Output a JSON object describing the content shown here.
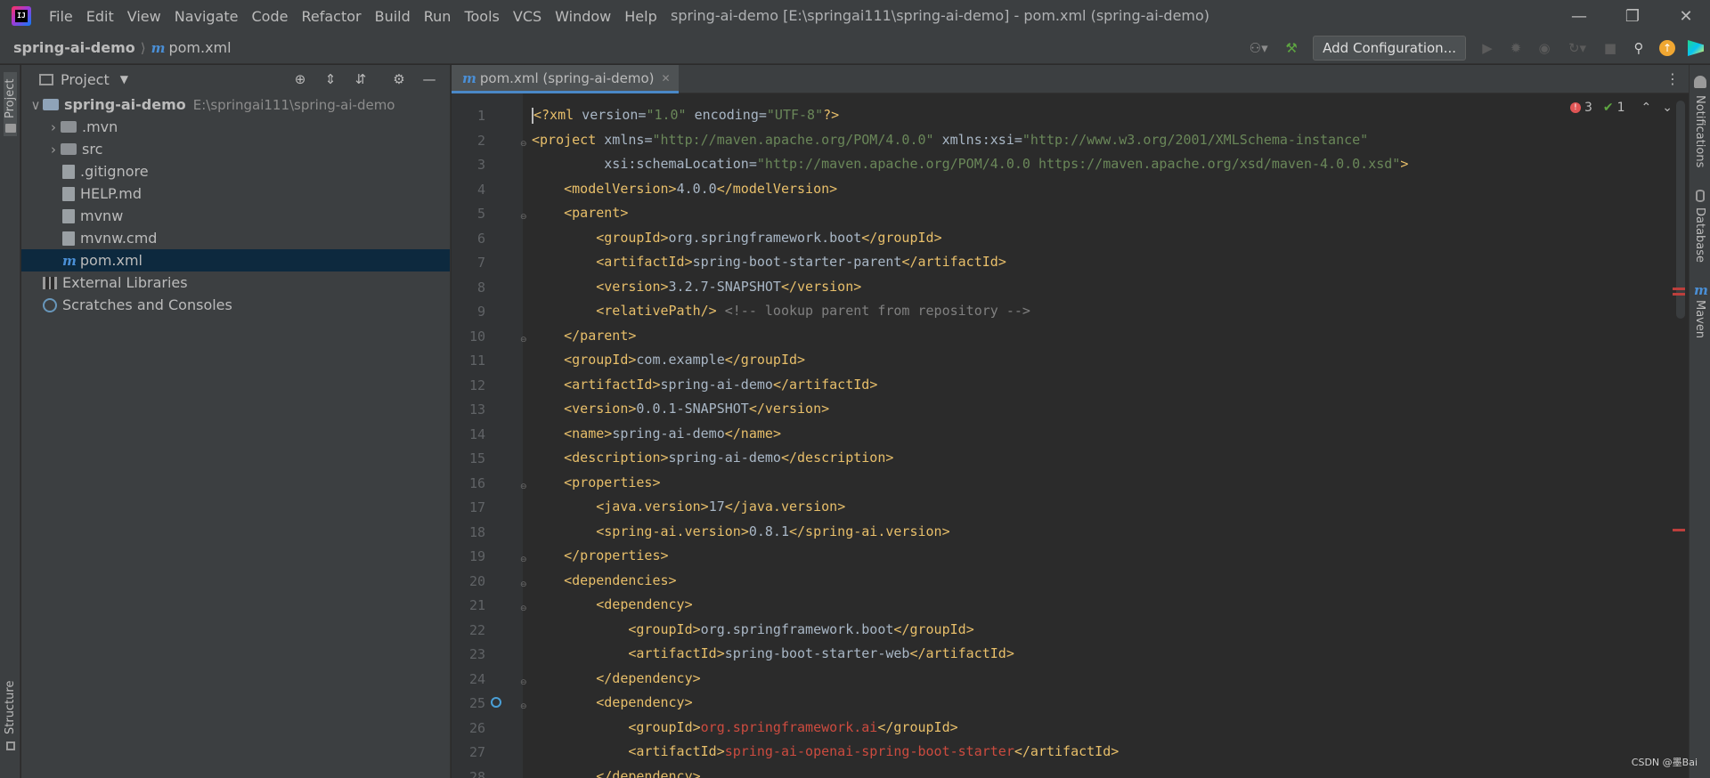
{
  "window": {
    "title": "spring-ai-demo [E:\\springai111\\spring-ai-demo] - pom.xml (spring-ai-demo)",
    "menu": [
      "File",
      "Edit",
      "View",
      "Navigate",
      "Code",
      "Refactor",
      "Build",
      "Run",
      "Tools",
      "VCS",
      "Window",
      "Help"
    ]
  },
  "breadcrumb": {
    "project": "spring-ai-demo",
    "file": "pom.xml"
  },
  "toolbar": {
    "add_configuration": "Add Configuration..."
  },
  "project_panel": {
    "title": "Project",
    "tree": [
      {
        "label": "spring-ai-demo",
        "path": "E:\\springai111\\spring-ai-demo",
        "type": "module",
        "indent": 0,
        "expanded": true
      },
      {
        "label": ".mvn",
        "type": "folder",
        "indent": 1,
        "expanded": false
      },
      {
        "label": "src",
        "type": "folder",
        "indent": 1,
        "expanded": false
      },
      {
        "label": ".gitignore",
        "type": "file",
        "indent": 1
      },
      {
        "label": "HELP.md",
        "type": "file",
        "indent": 1
      },
      {
        "label": "mvnw",
        "type": "file",
        "indent": 1
      },
      {
        "label": "mvnw.cmd",
        "type": "file",
        "indent": 1
      },
      {
        "label": "pom.xml",
        "type": "maven",
        "indent": 1,
        "selected": true
      },
      {
        "label": "External Libraries",
        "type": "libraries",
        "indent": 0
      },
      {
        "label": "Scratches and Consoles",
        "type": "scratches",
        "indent": 0
      }
    ]
  },
  "left_tools": {
    "project": "Project",
    "structure": "Structure"
  },
  "right_tools": {
    "notifications": "Notifications",
    "database": "Database",
    "maven": "Maven"
  },
  "editor": {
    "tab_label": "pom.xml (spring-ai-demo)",
    "inspection": {
      "errors": "3",
      "ok": "1"
    },
    "line_numbers": [
      "1",
      "2",
      "3",
      "4",
      "5",
      "6",
      "7",
      "8",
      "9",
      "10",
      "11",
      "12",
      "13",
      "14",
      "15",
      "16",
      "17",
      "18",
      "19",
      "20",
      "21",
      "22",
      "23",
      "24",
      "25",
      "26",
      "27",
      "28"
    ],
    "code_lines": [
      "<?xml version=\"1.0\" encoding=\"UTF-8\"?>",
      "<project xmlns=\"http://maven.apache.org/POM/4.0.0\" xmlns:xsi=\"http://www.w3.org/2001/XMLSchema-instance\"",
      "         xsi:schemaLocation=\"http://maven.apache.org/POM/4.0.0 https://maven.apache.org/xsd/maven-4.0.0.xsd\">",
      "    <modelVersion>4.0.0</modelVersion>",
      "    <parent>",
      "        <groupId>org.springframework.boot</groupId>",
      "        <artifactId>spring-boot-starter-parent</artifactId>",
      "        <version>3.2.7-SNAPSHOT</version>",
      "        <relativePath/> <!-- lookup parent from repository -->",
      "    </parent>",
      "    <groupId>com.example</groupId>",
      "    <artifactId>spring-ai-demo</artifactId>",
      "    <version>0.0.1-SNAPSHOT</version>",
      "    <name>spring-ai-demo</name>",
      "    <description>spring-ai-demo</description>",
      "    <properties>",
      "        <java.version>17</java.version>",
      "        <spring-ai.version>0.8.1</spring-ai.version>",
      "    </properties>",
      "    <dependencies>",
      "        <dependency>",
      "            <groupId>org.springframework.boot</groupId>",
      "            <artifactId>spring-boot-starter-web</artifactId>",
      "        </dependency>",
      "        <dependency>",
      "            <groupId>org.springframework.ai</groupId>",
      "            <artifactId>spring-ai-openai-spring-boot-starter</artifactId>",
      "        </dependency>"
    ],
    "fold_lines": [
      2,
      5,
      10,
      16,
      19,
      20,
      21,
      24,
      25
    ]
  },
  "watermark": "CSDN @墨Bai",
  "colors": {
    "tag": "#e8bf6a",
    "attr_value": "#6a8759",
    "comment": "#808080",
    "error": "#cc4b3f",
    "selection": "#0d293e",
    "accent": "#4a88c7"
  }
}
